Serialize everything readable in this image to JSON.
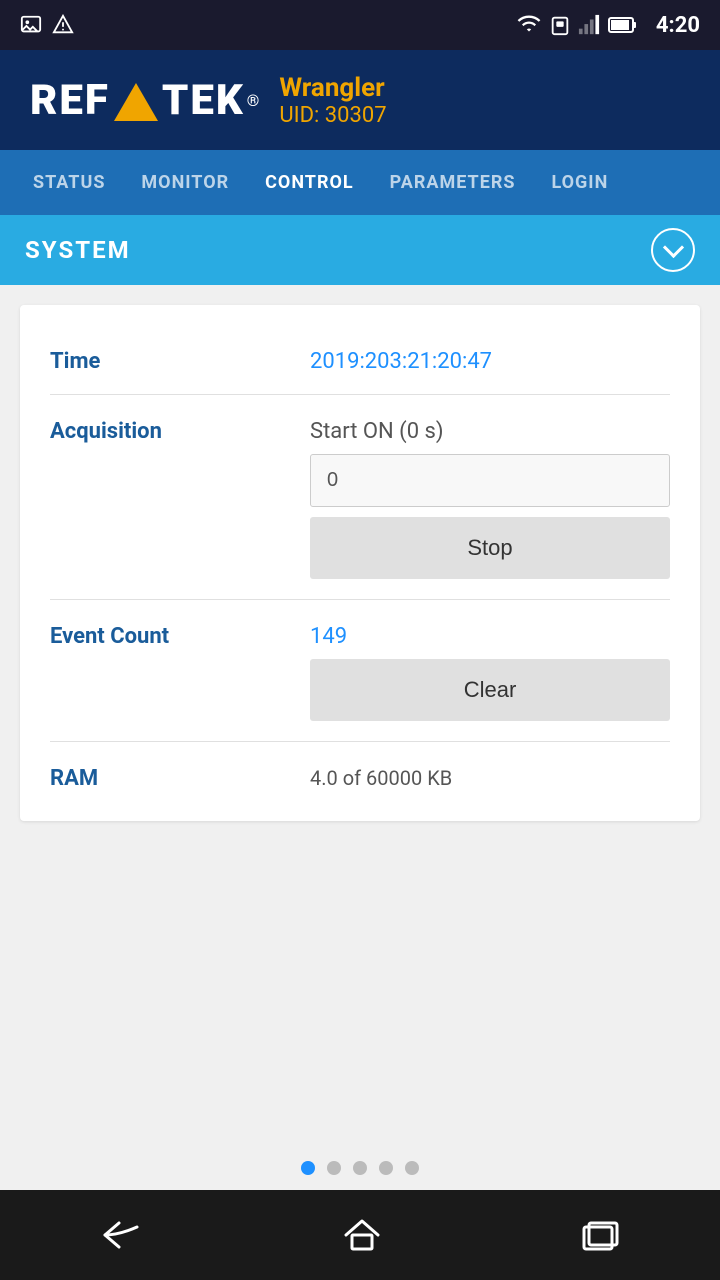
{
  "statusBar": {
    "time": "4:20",
    "icons": [
      "image-icon",
      "warning-icon",
      "wifi-icon",
      "sim-icon",
      "signal-icon",
      "battery-icon"
    ]
  },
  "header": {
    "logoLeft": "REF",
    "logoRight": "TEK",
    "registered": "®",
    "appName": "Wrangler",
    "uid": "UID: 30307"
  },
  "nav": {
    "items": [
      {
        "label": "STATUS",
        "active": false
      },
      {
        "label": "MONITOR",
        "active": false
      },
      {
        "label": "CONTROL",
        "active": true
      },
      {
        "label": "PARAMETERS",
        "active": false
      },
      {
        "label": "LOGIN",
        "active": false
      }
    ]
  },
  "section": {
    "title": "SYSTEM",
    "chevron": "chevron-down"
  },
  "rows": [
    {
      "label": "Time",
      "value": "2019:203:21:20:47",
      "type": "text",
      "valueColor": "blue"
    },
    {
      "label": "Acquisition",
      "subLabel": "Start ON (0 s)",
      "inputValue": "0",
      "buttonLabel": "Stop",
      "type": "input-button"
    },
    {
      "label": "Event Count",
      "value": "149",
      "buttonLabel": "Clear",
      "type": "value-button",
      "valueColor": "blue"
    },
    {
      "label": "RAM",
      "value": "4.0 of 60000 KB",
      "type": "text",
      "valueColor": "normal",
      "partial": true
    }
  ],
  "pageIndicators": {
    "total": 5,
    "active": 0
  },
  "bottomNav": {
    "back": "←",
    "home": "⌂",
    "recent": "▭"
  }
}
